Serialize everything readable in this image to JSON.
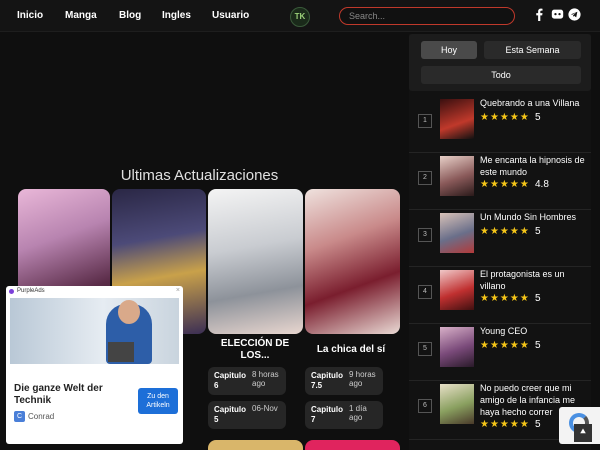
{
  "nav": {
    "items": [
      "Inicio",
      "Manga",
      "Blog",
      "Ingles",
      "Usuario"
    ],
    "logo_text": "TK",
    "search_placeholder": "Search...",
    "social_icons": [
      "facebook-icon",
      "discord-icon",
      "telegram-icon"
    ]
  },
  "updates": {
    "title": "Ultimas Actualizaciones",
    "cards": [
      {
        "title": "",
        "chapters": []
      },
      {
        "title": "",
        "chapters": []
      },
      {
        "title": "ELECCIÓN DE LOS...",
        "chapters": [
          {
            "label": "Capitulo 6",
            "time": "8 horas ago"
          },
          {
            "label": "Capitulo 5",
            "time": "06-Nov"
          }
        ]
      },
      {
        "title": "La chica del sí",
        "chapters": [
          {
            "label": "Capitulo 7.5",
            "time": "9 horas ago"
          },
          {
            "label": "Capitulo 7",
            "time": "1 día ago"
          }
        ]
      }
    ]
  },
  "ad": {
    "brand": "PurpleAds",
    "close": "×",
    "headline": "Die ganze Welt der Technik",
    "cta": "Zu den Artikeln",
    "advertiser_icon": "C",
    "advertiser": "Conrad"
  },
  "sidebar": {
    "periods": [
      "Hoy",
      "Esta Semana",
      "Todo"
    ],
    "active_period": "Hoy",
    "ranking": [
      {
        "rank": "1",
        "title": "Quebrando a una Villana",
        "stars": "★★★★★",
        "score": "5"
      },
      {
        "rank": "2",
        "title": "Me encanta la hipnosis de este mundo",
        "stars": "★★★★★",
        "score": "4.8"
      },
      {
        "rank": "3",
        "title": "Un Mundo Sin Hombres",
        "stars": "★★★★★",
        "score": "5"
      },
      {
        "rank": "4",
        "title": "El protagonista es un villano",
        "stars": "★★★★★",
        "score": "5"
      },
      {
        "rank": "5",
        "title": "Young CEO",
        "stars": "★★★★★",
        "score": "5"
      },
      {
        "rank": "6",
        "title": "No puedo creer que mi amigo de la infancia me haya hecho correr",
        "stars": "★★★★★",
        "score": "5"
      }
    ]
  },
  "colors": {
    "accent": "#c0392b",
    "star": "#f5c518",
    "background": "#0f0f0f"
  }
}
